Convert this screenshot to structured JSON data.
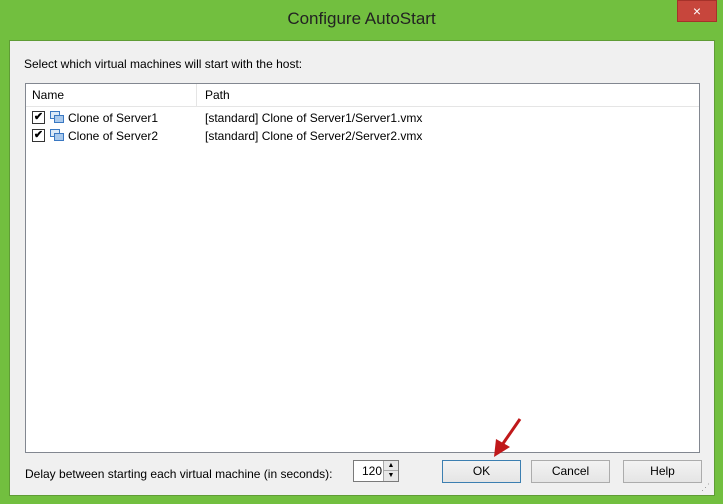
{
  "window": {
    "title": "Configure AutoStart",
    "close_glyph": "×"
  },
  "instruction": "Select which virtual machines will start with the host:",
  "list": {
    "columns": {
      "name": "Name",
      "path": "Path"
    },
    "rows": [
      {
        "checked": true,
        "name": "Clone of Server1",
        "path": "[standard] Clone of Server1/Server1.vmx"
      },
      {
        "checked": true,
        "name": "Clone of Server2",
        "path": "[standard] Clone of Server2/Server2.vmx"
      }
    ]
  },
  "delay": {
    "label": "Delay between starting each virtual machine (in seconds):",
    "value": "120"
  },
  "buttons": {
    "ok": "OK",
    "cancel": "Cancel",
    "help": "Help"
  },
  "check_glyph": "✔",
  "colors": {
    "frame": "#72bf3f",
    "close": "#c7463c",
    "arrow": "#c0181a"
  }
}
